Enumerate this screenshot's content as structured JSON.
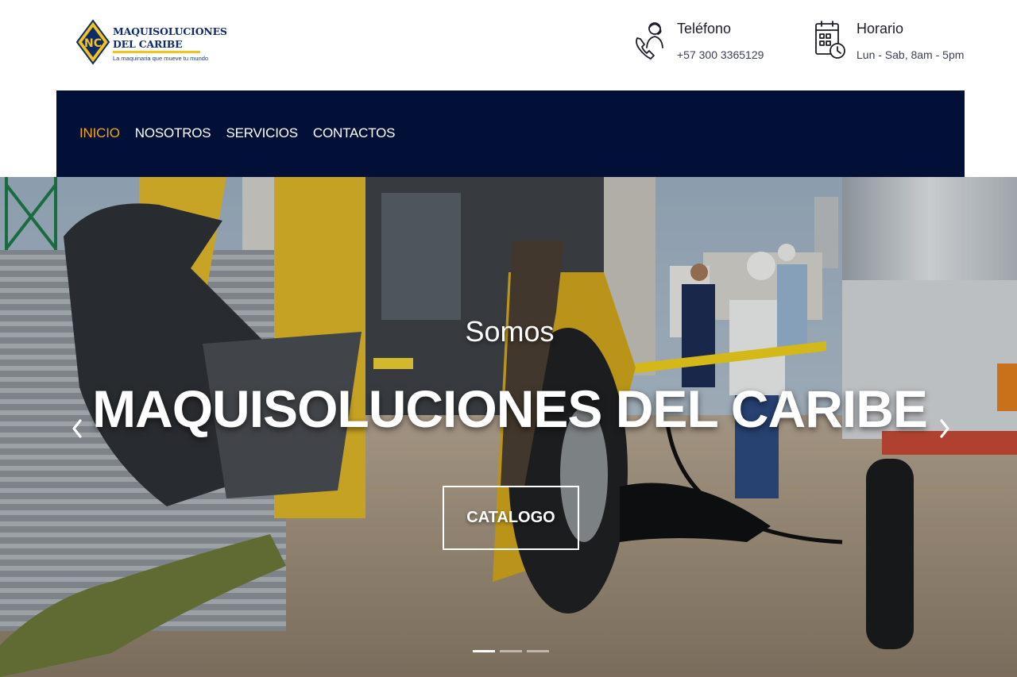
{
  "brand": {
    "name_line1": "MAQUISOLUCIONES",
    "name_line2": "DEL CARIBE",
    "tagline": "La maquinaria que mueve tu mundo",
    "logo_letters": "NC",
    "colors": {
      "navy": "#0d2a6b",
      "yellow": "#f3c21d"
    }
  },
  "contacts": {
    "phone": {
      "title": "Teléfono",
      "value": "+57 300 3365129",
      "icon": "phone-operator-icon"
    },
    "hours": {
      "title": "Horario",
      "value": "Lun - Sab, 8am - 5pm",
      "icon": "calendar-clock-icon"
    }
  },
  "nav": {
    "items": [
      {
        "label": "INICIO",
        "active": true
      },
      {
        "label": "NOSOTROS",
        "active": false
      },
      {
        "label": "SERVICIOS",
        "active": false
      },
      {
        "label": "CONTACTOS",
        "active": false
      }
    ],
    "colors": {
      "background": "#020f36",
      "active": "#f4a51c",
      "text": "#ffffff"
    }
  },
  "hero": {
    "subtitle": "Somos",
    "title": "MAQUISOLUCIONES DEL CARIBE",
    "cta_label": "CATALOGO",
    "prev_icon": "chevron-left-icon",
    "next_icon": "chevron-right-icon",
    "slide_count": 3,
    "active_slide": 1
  }
}
